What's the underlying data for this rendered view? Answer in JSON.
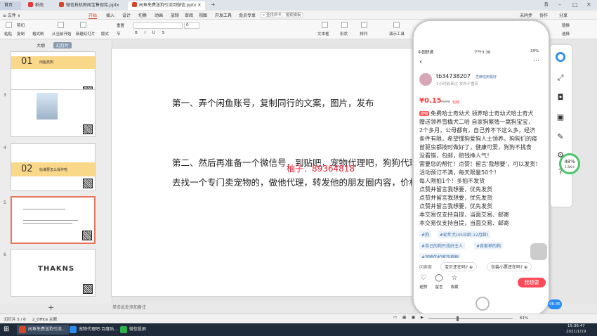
{
  "titlebar": {
    "tabs": [
      {
        "label": "首页"
      },
      {
        "label": "稻壳"
      },
      {
        "label": "微信技机郎闻宝售现宪.pptx"
      },
      {
        "label": "闲鱼免费送狗引流到微信.pptx"
      }
    ],
    "user_initial": "B"
  },
  "menubar": {
    "file_label": "≡ 文件 ∨",
    "items": [
      "开始",
      "插入",
      "设计",
      "切换",
      "动画",
      "放映",
      "审阅",
      "视图",
      "开发工具",
      "会员专享"
    ],
    "search_placeholder": "查找命令、搜索模板",
    "right_items": [
      "未同步",
      "协作",
      "分享"
    ]
  },
  "ribbon": {
    "labels": [
      "粘贴",
      "剪切",
      "复制",
      "格式刷",
      "从当前开始",
      "新建幻灯片",
      "版式",
      "节",
      "重置",
      "文本框",
      "形状",
      "排列",
      "演示工具",
      "替换",
      "选择"
    ],
    "font_size": "0"
  },
  "left_panel": {
    "tabs": [
      "大纲",
      "幻灯片"
    ],
    "slides": [
      {
        "num": "",
        "heading_num": "01",
        "heading": "闲鱼案例"
      },
      {
        "num": "3",
        "heading_num": "",
        "heading": ""
      },
      {
        "num": "4",
        "heading_num": "02",
        "heading": "给谁要怎么操作啦"
      },
      {
        "num": "5",
        "heading_num": "",
        "heading": ""
      },
      {
        "num": "6",
        "heading_num": "",
        "heading": "THAKNS"
      }
    ]
  },
  "slide": {
    "line1": "第一、弄个闲鱼账号，复制同行的文案，图片，发布",
    "line2": "第二、然后再准备一个微信号，到贴吧，宠物代理吧，狗狗代理吧",
    "line3": "去找一个专门卖宠物的，做他代理，转发他的朋友圈内容，价格在价"
  },
  "watermark": "柚子：89364818",
  "notes_placeholder": "单击此处添加备注",
  "statusbar": {
    "slide_pos": "幻灯片 5 / 6",
    "theme": "2_Office 主题",
    "zoom": "61%"
  },
  "taskbar": {
    "items": [
      "闲鱼免费送狗引流...",
      "宠物代理吧-百度贴...",
      "微信投屏"
    ],
    "time": "15:36:47",
    "date": "2021/1/19"
  },
  "phone": {
    "carrier": "中国联通",
    "time": "下午3:36",
    "battery": "39%",
    "username": "tb34738207",
    "badge": "芝麻信用极好",
    "meta": "3小时前来过  发布于重庆",
    "price": "¥0.15",
    "old_price": "¥299",
    "shipping": "包邮",
    "desc_lines": [
      "免费哈士奇幼犬 领养哈士奇幼犬哈士奇犬",
      "赠送领养雪橇犬二哈  自家狗繁殖一窝狗宝宝，",
      "2个多月，公母都有，自己养不下这么多，经济",
      "条件有限，希望懂狗爱狗人士领养，狗狗们的疫",
      "苗驱虫都按时做好了，健康可爱，狗狗不挑食",
      "没看错，包邮，赔钱挣人气！",
      "需要您的帮忙！点赞！留言‘我想要’，可以发货！",
      "活动预订不满，每天限量50个！",
      "每人限拍1个！多拍不发货",
      "点赞并留言我想要，优先发货",
      "点赞并留言我想要，优先发货",
      "点赞并留言我想要，优先发货",
      "本交易仅支持自提，当面交易、邮寄",
      "本交易仅支持自提，当面交易、邮寄"
    ],
    "desc_tag": "宠物",
    "tags": [
      "#狗",
      "#幼年犬(45日龄-12月龄)",
      "#自己的狗只找好主人",
      "#自家养的狗",
      "#宠物的护家宠养物"
    ],
    "questions_label": "问卖家",
    "questions": [
      "宝贝还在吗?",
      "包装小票还在吗?"
    ],
    "bottom": {
      "like": "超赞",
      "comment": "留言",
      "fav": "收藏",
      "want": "我想要"
    }
  },
  "side_tools": {
    "progress": "48%",
    "speed": "1.5K/s",
    "timer": "06:35"
  }
}
